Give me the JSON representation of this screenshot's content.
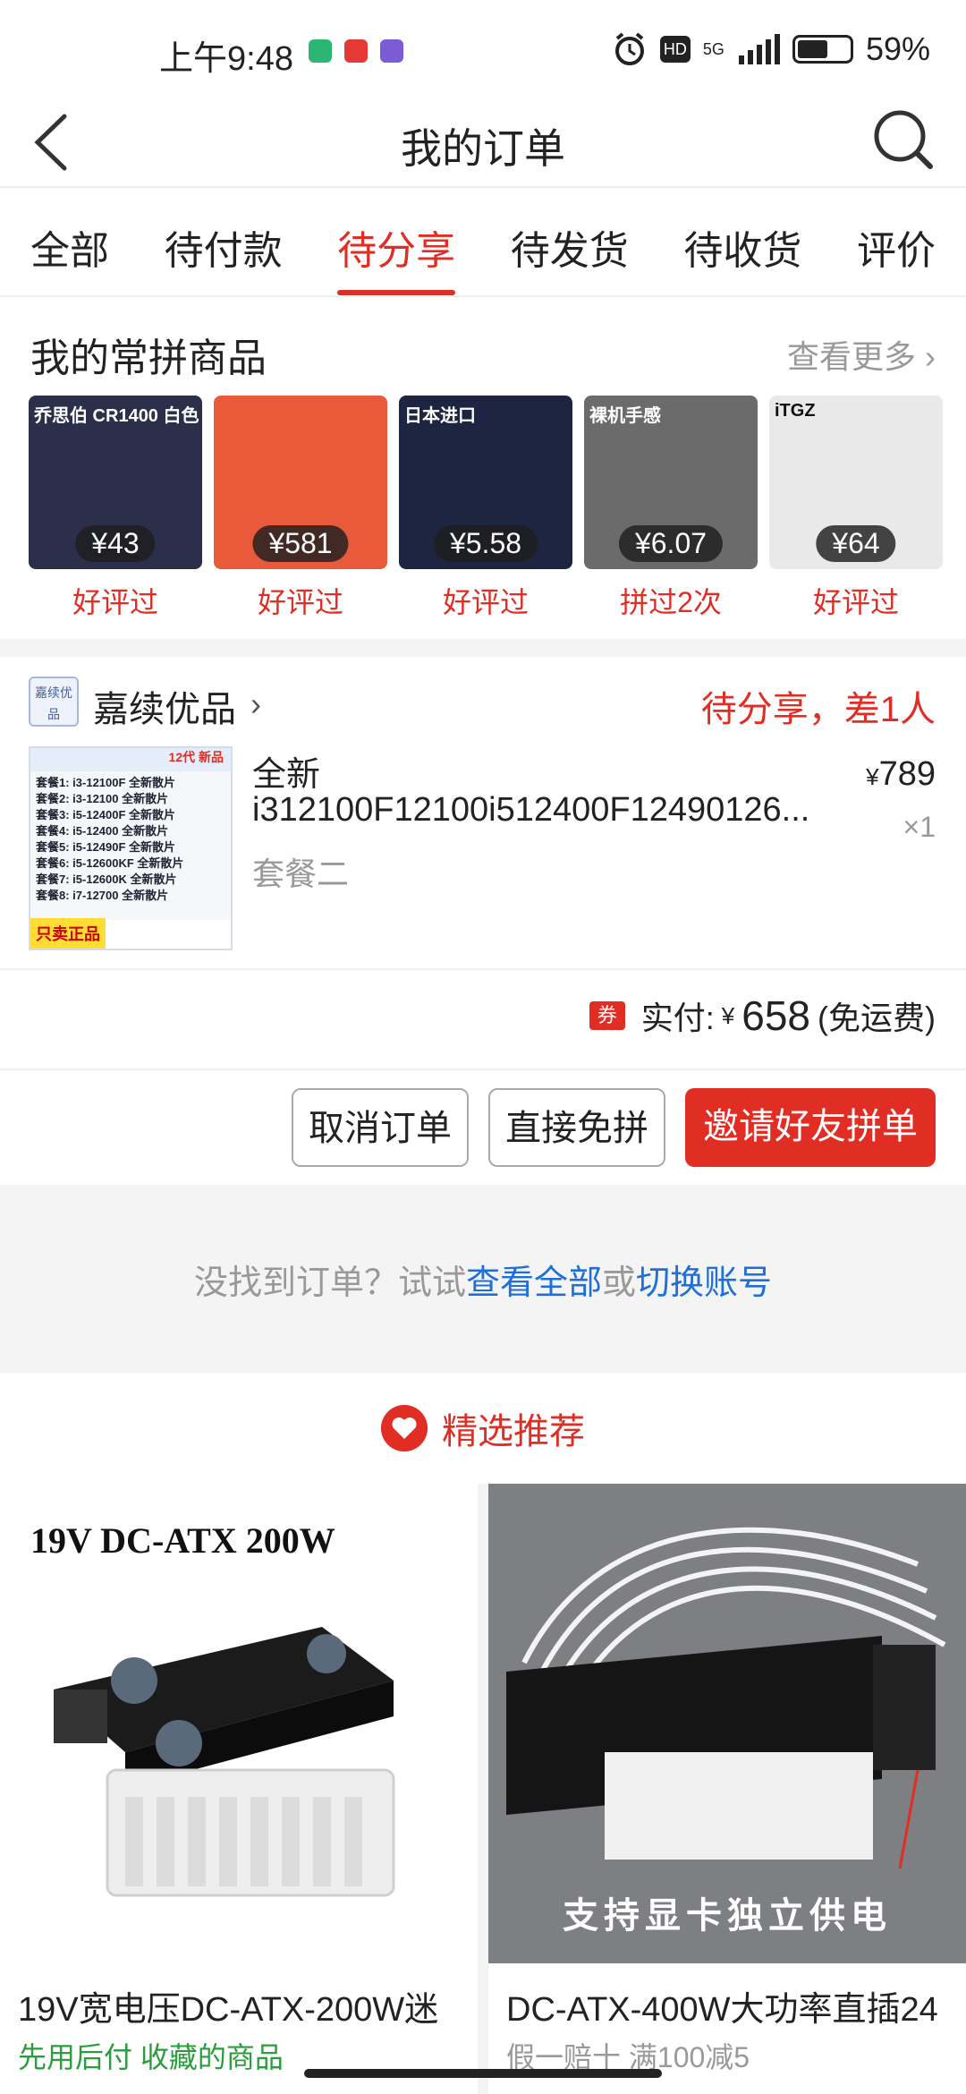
{
  "status_bar": {
    "time": "上午9:48",
    "network": "5G",
    "hd_label": "HD",
    "battery_text": "59%",
    "battery_level": 0.59
  },
  "nav": {
    "title": "我的订单",
    "back_icon": "chevron-left-icon",
    "search_icon": "search-icon"
  },
  "tabs": [
    {
      "label": "全部",
      "active": false
    },
    {
      "label": "待付款",
      "active": false
    },
    {
      "label": "待分享",
      "active": true
    },
    {
      "label": "待发货",
      "active": false
    },
    {
      "label": "待收货",
      "active": false
    },
    {
      "label": "评价",
      "active": false
    }
  ],
  "frequent": {
    "title": "我的常拼商品",
    "more": "查看更多",
    "items": [
      {
        "caption": "乔思伯 CR1400 白色",
        "price": "¥43",
        "label": "好评过"
      },
      {
        "caption": "",
        "price": "¥581",
        "label": "好评过"
      },
      {
        "caption": "日本进口",
        "price": "¥5.58",
        "label": "好评过"
      },
      {
        "caption": "裸机手感",
        "price": "¥6.07",
        "label": "拼过2次"
      },
      {
        "caption": "iTGZ",
        "price": "¥64",
        "label": "好评过"
      }
    ]
  },
  "order": {
    "shop_logo_text": "嘉续优品",
    "shop_name": "嘉续优品",
    "status": "待分享，差1人",
    "product_title_line1": "全新",
    "product_title_line2": "i312100F12100i512400F12490126...",
    "spec": "套餐二",
    "price_symbol": "¥",
    "price": "789",
    "qty": "×1",
    "coupon_badge": "券",
    "paid_label": "实付:",
    "paid_symbol": "¥",
    "paid_amount": "658",
    "shipping_note": "(免运费)",
    "buttons": {
      "cancel": "取消订单",
      "direct": "直接免拼",
      "invite": "邀请好友拼单"
    }
  },
  "not_found": {
    "prefix": "没找到订单？试试",
    "link1": "查看全部",
    "middle": "或",
    "link2": "切换账号"
  },
  "recommend": {
    "title": "精选推荐",
    "items": [
      {
        "name": "19V宽电压DC-ATX-200W迷",
        "sub": "先用后付 收藏的商品",
        "image_caption": "19V DC-ATX 200W"
      },
      {
        "name": "DC-ATX-400W大功率直插24",
        "sub": "假一赔十 满100减5",
        "image_caption": "支持显卡独立供电"
      }
    ]
  }
}
